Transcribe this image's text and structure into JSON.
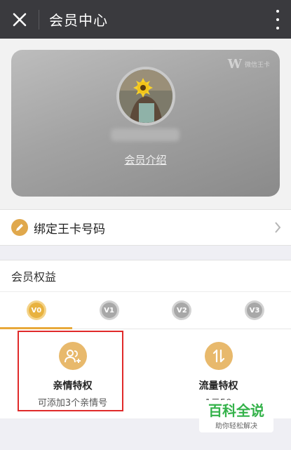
{
  "header": {
    "title": "会员中心"
  },
  "card": {
    "brand_text": "微信王卡",
    "intro_link": "会员介绍"
  },
  "bind": {
    "label": "绑定王卡号码"
  },
  "rights": {
    "title": "会员权益"
  },
  "levels": [
    {
      "label": "V0",
      "active": true
    },
    {
      "label": "V1",
      "active": false
    },
    {
      "label": "V2",
      "active": false
    },
    {
      "label": "V3",
      "active": false
    }
  ],
  "benefits": [
    {
      "name": "亲情特权",
      "desc": "可添加3个亲情号",
      "icon": "family-add-icon"
    },
    {
      "name": "流量特权",
      "desc": "1元50",
      "icon": "data-transfer-icon"
    }
  ],
  "watermark": {
    "title": "百科全说",
    "subtitle": "助你轻松解决"
  },
  "colors": {
    "gold": "#e8b23f",
    "header": "#3a3a3e",
    "highlight": "#e02a2a"
  }
}
